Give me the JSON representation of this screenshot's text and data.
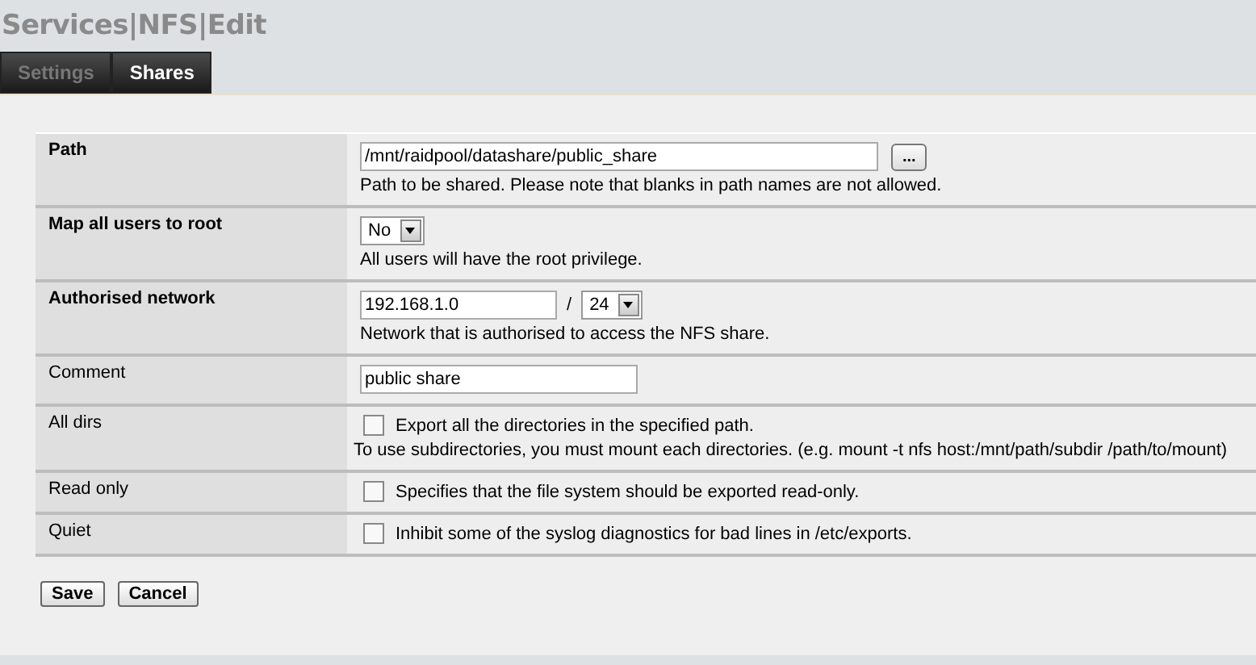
{
  "title": "Services|NFS|Edit",
  "tabs": [
    {
      "label": "Settings",
      "selected": false
    },
    {
      "label": "Shares",
      "selected": true
    }
  ],
  "rows": [
    {
      "kind": "path",
      "label": "Path",
      "required": true,
      "value": "/mnt/raidpool/datashare/public_share",
      "button": "...",
      "description": "Path to be shared. Please note that blanks in path names are not allowed."
    },
    {
      "kind": "select",
      "label": "Map all users to root",
      "required": true,
      "value": "No",
      "description": "All users will have the root privilege."
    },
    {
      "kind": "network",
      "label": "Authorised network",
      "required": true,
      "value": "192.168.1.0",
      "separator": "/",
      "mask": "24",
      "description": "Network that is authorised to access the NFS share."
    },
    {
      "kind": "text",
      "label": "Comment",
      "required": false,
      "value": "public share"
    },
    {
      "kind": "checkbox",
      "label": "All dirs",
      "required": false,
      "checked": false,
      "caption": "Export all the directories in the specified path.",
      "description": "To use subdirectories, you must mount each directories. (e.g. mount -t nfs host:/mnt/path/subdir /path/to/mount)"
    },
    {
      "kind": "checkbox",
      "label": "Read only",
      "required": false,
      "checked": false,
      "caption": "Specifies that the file system should be exported read-only."
    },
    {
      "kind": "checkbox",
      "label": "Quiet",
      "required": false,
      "checked": false,
      "caption": "Inhibit some of the syslog diagnostics for bad lines in /etc/exports."
    }
  ],
  "buttons": [
    "Save",
    "Cancel"
  ]
}
